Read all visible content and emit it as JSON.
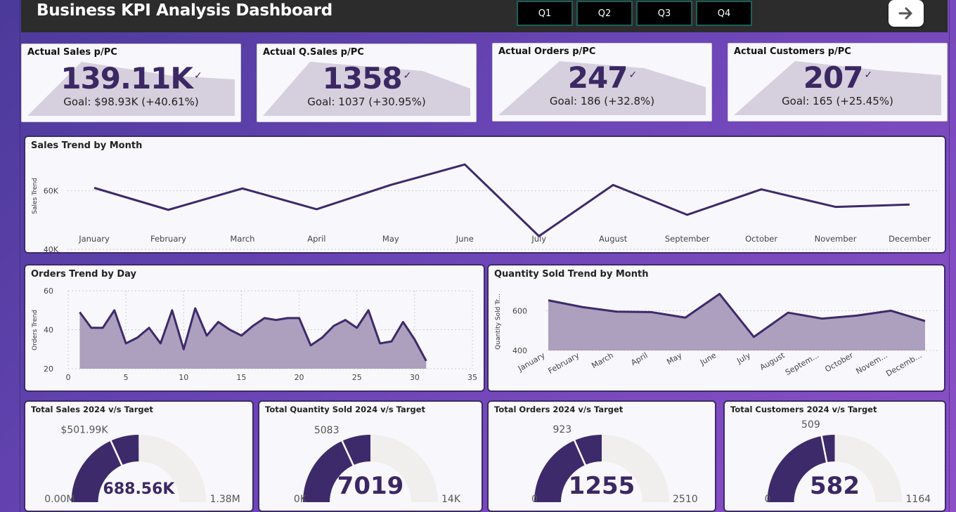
{
  "header": {
    "title": "Business KPI Analysis Dashboard",
    "quarters": [
      "Q1",
      "Q2",
      "Q3",
      "Q4"
    ],
    "nav_icon": "arrow-right-icon"
  },
  "kpis": [
    {
      "label": "Actual Sales p/PC",
      "value": "139.11K",
      "check": "✓",
      "goal": "Goal: $98.93K (+40.61%)"
    },
    {
      "label": "Actual Q.Sales p/PC",
      "value": "1358",
      "check": "✓",
      "goal": "Goal: 1037 (+30.95%)"
    },
    {
      "label": "Actual Orders p/PC",
      "value": "247",
      "check": "✓",
      "goal": "Goal: 186 (+32.8%)"
    },
    {
      "label": "Actual Customers p/PC",
      "value": "207",
      "check": "✓",
      "goal": "Goal: 165 (+25.45%)"
    }
  ],
  "chart_data": [
    {
      "type": "line",
      "title": "Sales Trend by Month",
      "ylabel": "Sales Trend",
      "xlabel": "",
      "categories": [
        "January",
        "February",
        "March",
        "April",
        "May",
        "June",
        "July",
        "August",
        "September",
        "October",
        "November",
        "December"
      ],
      "values": [
        61000,
        53500,
        60800,
        53700,
        62000,
        69000,
        44500,
        62000,
        51800,
        60500,
        54500,
        55300
      ],
      "yticks": [
        "40K",
        "60K"
      ],
      "ylim": [
        40000,
        70000
      ],
      "grid": true,
      "color": "#3d2a6b"
    },
    {
      "type": "area",
      "title": "Orders Trend by Day",
      "ylabel": "Orders Trend",
      "xlabel": "",
      "x": [
        1,
        2,
        3,
        4,
        5,
        6,
        7,
        8,
        9,
        10,
        11,
        12,
        13,
        14,
        15,
        16,
        17,
        18,
        19,
        20,
        21,
        22,
        23,
        24,
        25,
        26,
        27,
        28,
        29,
        30,
        31
      ],
      "values": [
        49,
        41,
        41,
        50,
        33,
        36,
        41,
        33,
        50,
        30,
        51,
        37,
        44,
        40,
        37,
        42,
        46,
        45,
        46,
        46,
        32,
        36,
        42,
        45,
        41,
        50,
        33,
        34,
        44,
        35,
        24
      ],
      "xticks": [
        "0",
        "5",
        "10",
        "15",
        "20",
        "25",
        "30",
        "35"
      ],
      "yticks": [
        "20",
        "40",
        "60"
      ],
      "xlim": [
        0,
        35
      ],
      "ylim": [
        20,
        60
      ],
      "grid": true,
      "color": "#3d2a6b"
    },
    {
      "type": "area",
      "title": "Quantity Sold Trend by Month",
      "ylabel": "Quantity Sold Tr...",
      "xlabel": "",
      "categories": [
        "January",
        "February",
        "March",
        "April",
        "May",
        "June",
        "July",
        "August",
        "Septem...",
        "October",
        "Novem...",
        "Decemb..."
      ],
      "values": [
        652,
        618,
        595,
        593,
        565,
        684,
        468,
        590,
        560,
        575,
        600,
        548
      ],
      "yticks": [
        "400",
        "600"
      ],
      "ylim": [
        400,
        700
      ],
      "grid": true,
      "color": "#3d2a6b"
    }
  ],
  "gauges": [
    {
      "title": "Total Sales 2024 v/s Target",
      "value": 688.56,
      "max": 1380,
      "target": 501.99,
      "value_label": "688.56K",
      "target_label": "$501.99K",
      "min_label": "0.00M",
      "max_label": "1.38M"
    },
    {
      "title": "Total Quantity Sold 2024 v/s Target",
      "value": 7019,
      "max": 14038,
      "target": 5083,
      "value_label": "7019",
      "target_label": "5083",
      "min_label": "0K",
      "max_label": "14K"
    },
    {
      "title": "Total Orders 2024 v/s Target",
      "value": 1255,
      "max": 2510,
      "target": 923,
      "value_label": "1255",
      "target_label": "923",
      "min_label": "0",
      "max_label": "2510"
    },
    {
      "title": "Total Customers 2024 v/s Target",
      "value": 582,
      "max": 1164,
      "target": 509,
      "value_label": "582",
      "target_label": "509",
      "min_label": "0",
      "max_label": "1164"
    }
  ],
  "colors": {
    "accent": "#3d2a6b",
    "fill": "#a89bb8",
    "track": "#f0efed"
  }
}
